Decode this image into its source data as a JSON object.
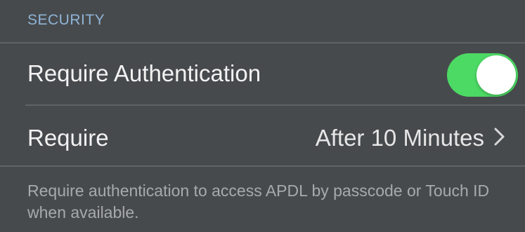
{
  "security": {
    "header": "SECURITY",
    "require_authentication": {
      "label": "Require Authentication",
      "enabled": true,
      "toggle_color": "#4cd964"
    },
    "require": {
      "label": "Require",
      "value": "After 10 Minutes",
      "icon": "chevron-right-icon"
    },
    "footer": "Require authentication to access APDL by passcode or Touch ID when available."
  }
}
